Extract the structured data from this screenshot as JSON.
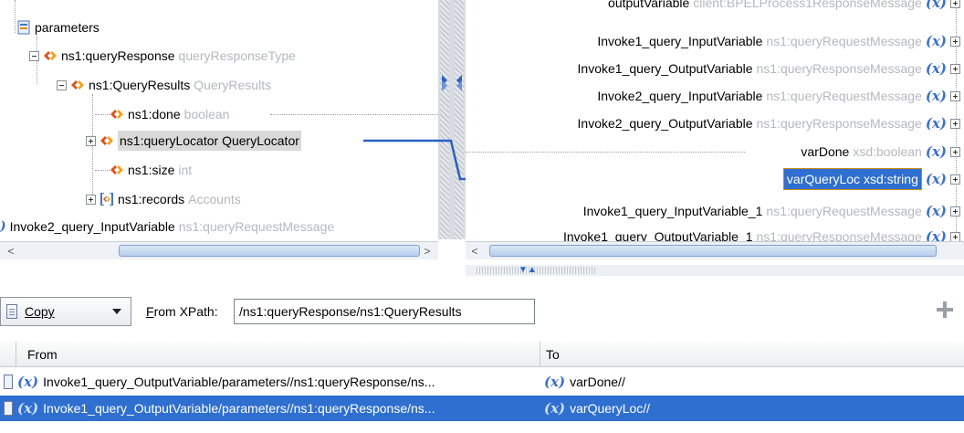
{
  "source_tree": {
    "nodes": [
      {
        "name": "parameters",
        "type": ""
      },
      {
        "name": "ns1:queryResponse",
        "type": "queryResponseType"
      },
      {
        "name": "ns1:QueryResults",
        "type": "QueryResults"
      },
      {
        "name": "ns1:done",
        "type": "boolean"
      },
      {
        "name": "ns1:queryLocator",
        "type": "QueryLocator"
      },
      {
        "name": "ns1:size",
        "type": "int"
      },
      {
        "name": "ns1:records",
        "type": "Accounts"
      },
      {
        "name": "Invoke2_query_InputVariable",
        "type": "ns1:queryRequestMessage"
      }
    ]
  },
  "target_tree": {
    "rows": [
      {
        "name": "outputVariable",
        "type": "client:BPELProcess1ResponseMessage"
      },
      {
        "name": "Invoke1_query_InputVariable",
        "type": "ns1:queryRequestMessage"
      },
      {
        "name": "Invoke1_query_OutputVariable",
        "type": "ns1:queryResponseMessage"
      },
      {
        "name": "Invoke2_query_InputVariable",
        "type": "ns1:queryRequestMessage"
      },
      {
        "name": "Invoke2_query_OutputVariable",
        "type": "ns1:queryResponseMessage"
      },
      {
        "name": "varDone",
        "type": "xsd:boolean"
      },
      {
        "name": "varQueryLoc xsd:string",
        "type": ""
      },
      {
        "name": "Invoke1_query_InputVariable_1",
        "type": "ns1:queryRequestMessage"
      },
      {
        "name": "Invoke1_query_OutputVariable_1",
        "type": "ns1:queryResponseMessage"
      }
    ],
    "var_symbol": "(x)"
  },
  "toolbar": {
    "copy_label": "Copy",
    "xpath_label_prefix": "F",
    "xpath_label_rest": "rom XPath:",
    "xpath_value": "/ns1:queryResponse/ns1:QueryResults"
  },
  "grid": {
    "headers": [
      "From",
      "To"
    ],
    "rows": [
      {
        "from": "Invoke1_query_OutputVariable/parameters//ns1:queryResponse/ns...",
        "to": "varDone//"
      },
      {
        "from": "Invoke1_query_OutputVariable/parameters//ns1:queryResponse/ns...",
        "to": "varQueryLoc//"
      }
    ]
  },
  "colors": {
    "accent": "#2f6fd0",
    "var_blue": "#3a6fc8",
    "mapping_line": "#2b5fc4"
  }
}
